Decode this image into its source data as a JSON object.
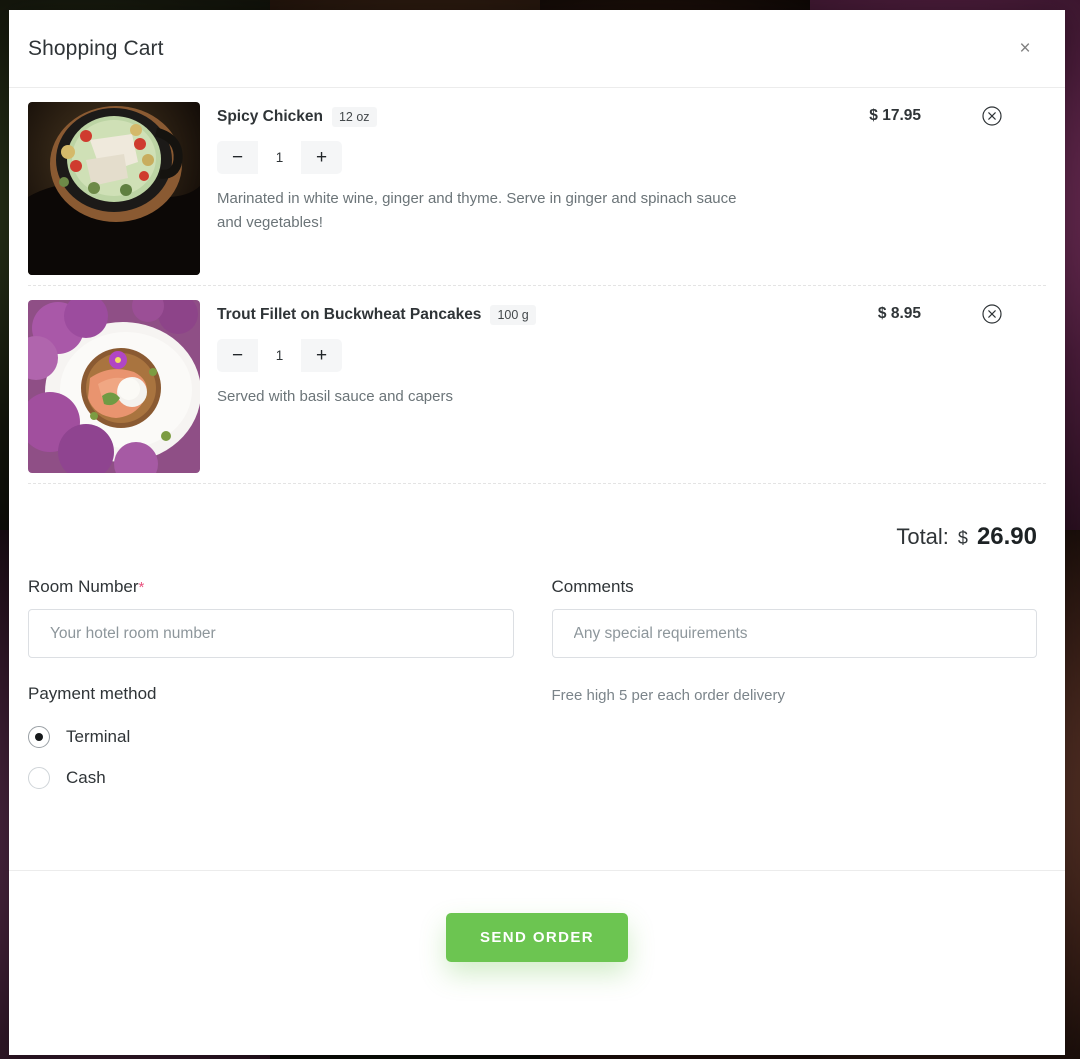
{
  "modal": {
    "title": "Shopping Cart",
    "close_label": "×",
    "close_icon": "close-icon"
  },
  "cart": {
    "items": [
      {
        "name": "Spicy Chicken",
        "weight": "12 oz",
        "quantity": "1",
        "decrement_label": "−",
        "increment_label": "+",
        "description": "Marinated in white wine, ginger and thyme. Serve in ginger and spinach sauce and vegetables!",
        "price": "$ 17.95",
        "remove_icon": "remove-circle-icon",
        "image_alt": "spicy-chicken-photo"
      },
      {
        "name": "Trout Fillet on Buckwheat Pancakes",
        "weight": "100 g",
        "quantity": "1",
        "decrement_label": "−",
        "increment_label": "+",
        "description": "Served with basil sauce and capers",
        "price": "$ 8.95",
        "remove_icon": "remove-circle-icon",
        "image_alt": "trout-fillet-photo"
      }
    ],
    "total_label": "Total:",
    "total_currency": "$",
    "total_value": "26.90"
  },
  "form": {
    "room": {
      "label": "Room Number",
      "required_mark": "*",
      "value": "",
      "placeholder": "Your hotel room number"
    },
    "comments": {
      "label": "Comments",
      "value": "",
      "placeholder": "Any special requirements"
    },
    "payment": {
      "title": "Payment method",
      "options": [
        {
          "label": "Terminal",
          "selected": true
        },
        {
          "label": "Cash",
          "selected": false
        }
      ]
    },
    "delivery_note": "Free high 5 per each order delivery"
  },
  "footer": {
    "submit_label": "SEND ORDER"
  },
  "colors": {
    "accent_green": "#6cc551",
    "required_pink": "#e8527f",
    "text_primary": "#2f3437",
    "text_muted": "#6b7478"
  }
}
